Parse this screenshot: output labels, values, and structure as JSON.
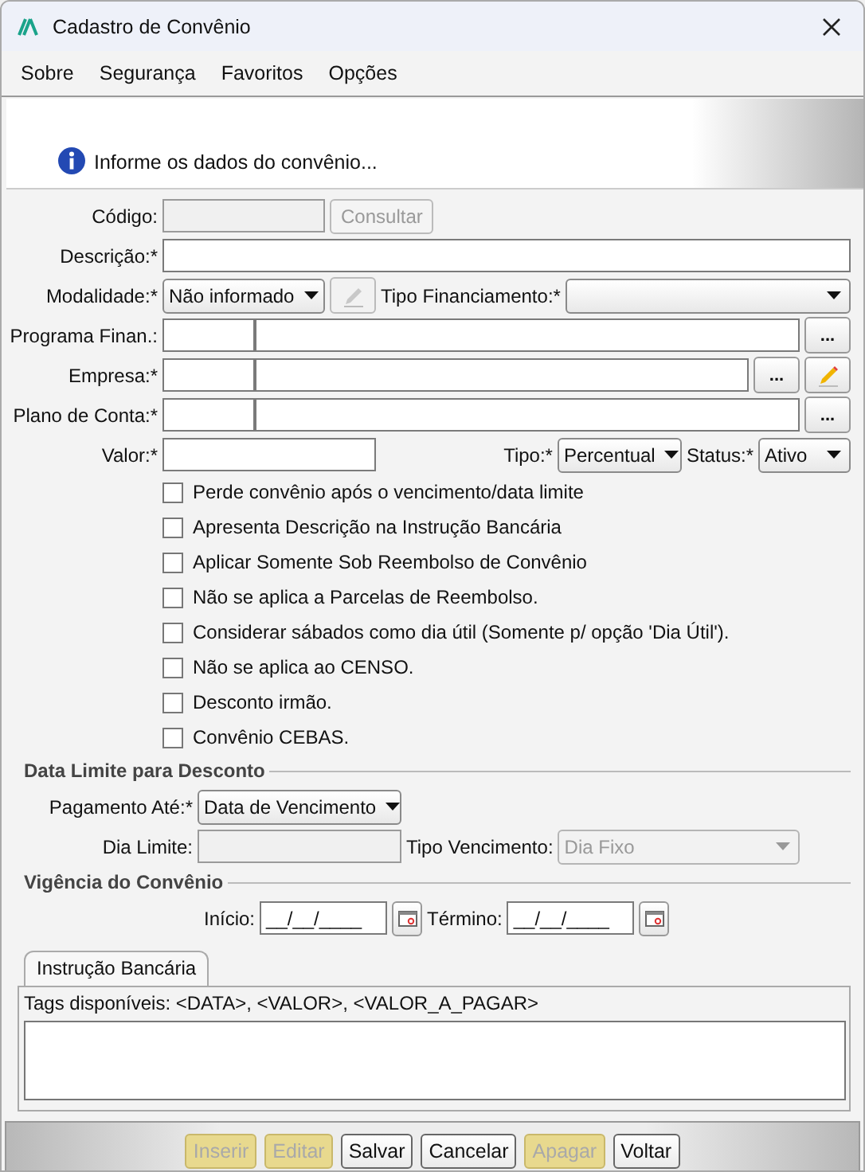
{
  "window": {
    "title": "Cadastro de Convênio"
  },
  "menu": [
    {
      "label": "Sobre"
    },
    {
      "label": "Segurança"
    },
    {
      "label": "Favoritos"
    },
    {
      "label": "Opções"
    }
  ],
  "info": {
    "message": "Informe os dados do convênio..."
  },
  "form": {
    "codigo": {
      "label": "Código:",
      "disabled": true
    },
    "consultar": {
      "label": "Consultar",
      "disabled": true
    },
    "descricao": {
      "label": "Descrição:*"
    },
    "modalidade": {
      "label": "Modalidade:*",
      "value": "Não informado",
      "edit_disabled": true
    },
    "tipo_financiamento": {
      "label": "Tipo Financiamento:*"
    },
    "lookups": [
      {
        "label": "Programa Finan.:",
        "browse": "...",
        "edit": false
      },
      {
        "label": "Empresa:*",
        "browse": "...",
        "edit": true
      },
      {
        "label": "Plano de Conta:*",
        "browse": "...",
        "edit": false
      }
    ],
    "valor": {
      "label": "Valor:*"
    },
    "tipo": {
      "label": "Tipo:*",
      "value": "Percentual"
    },
    "status": {
      "label": "Status:*",
      "value": "Ativo"
    }
  },
  "options": [
    {
      "label": "Perde convênio após o vencimento/data limite",
      "checked": false
    },
    {
      "label": "Apresenta Descrição na Instrução Bancária",
      "checked": false
    },
    {
      "label": "Aplicar Somente Sob Reembolso de Convênio",
      "checked": false
    },
    {
      "label": "Não se aplica a Parcelas de Reembolso.",
      "checked": false
    },
    {
      "label": "Considerar sábados como dia útil (Somente p/ opção 'Dia Útil').",
      "checked": false
    },
    {
      "label": "Não se aplica ao CENSO.",
      "checked": false
    },
    {
      "label": "Desconto irmão.",
      "checked": false
    },
    {
      "label": "Convênio CEBAS.",
      "checked": false
    }
  ],
  "data_limite": {
    "title": "Data Limite para Desconto",
    "pagamento": {
      "label": "Pagamento Até:*",
      "value": "Data de Vencimento"
    },
    "dia_limite": {
      "label": "Dia Limite:",
      "disabled": true
    },
    "tipo_vencimento": {
      "label": "Tipo Vencimento:",
      "value": "Dia Fixo",
      "disabled": true
    }
  },
  "vigencia": {
    "title": "Vigência do Convênio",
    "inicio": {
      "label": "Início:",
      "value": "__/__/____"
    },
    "termino": {
      "label": "Término:",
      "value": "__/__/____"
    }
  },
  "tabs": [
    {
      "label": "Instrução Bancária",
      "selected": true
    }
  ],
  "instrucao": {
    "tags": "Tags disponíveis: <DATA>, <VALOR>, <VALOR_A_PAGAR>"
  },
  "buttons": [
    {
      "label": "Inserir",
      "disabled": true
    },
    {
      "label": "Editar",
      "disabled": true
    },
    {
      "label": "Salvar",
      "disabled": false
    },
    {
      "label": "Cancelar",
      "disabled": false
    },
    {
      "label": "Apagar",
      "disabled": true
    },
    {
      "label": "Voltar",
      "disabled": false
    }
  ]
}
